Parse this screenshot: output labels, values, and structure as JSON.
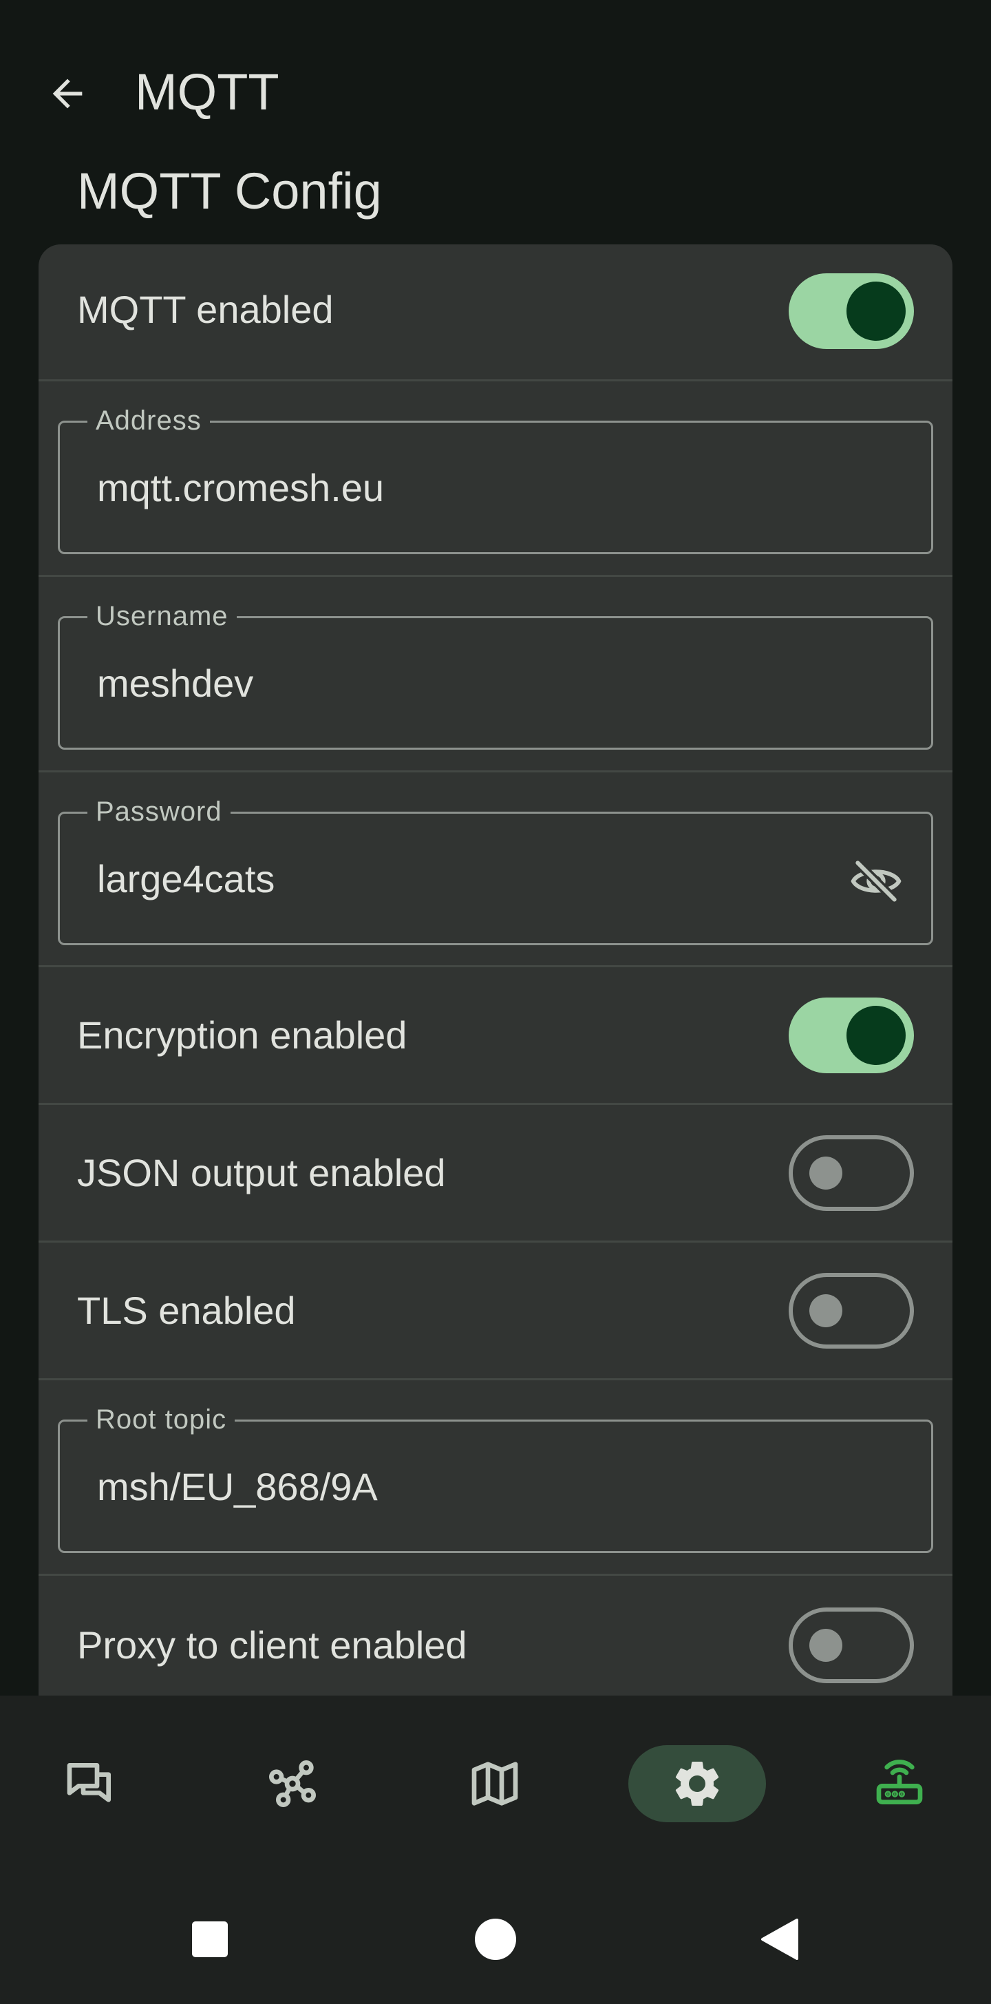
{
  "app_bar": {
    "title": "MQTT",
    "back_icon": "arrow-left-icon"
  },
  "section_title": "MQTT Config",
  "settings": {
    "mqtt_enabled": {
      "label": "MQTT enabled",
      "checked": true
    },
    "address": {
      "legend": "Address",
      "value": "mqtt.cromesh.eu"
    },
    "username": {
      "legend": "Username",
      "value": "meshdev"
    },
    "password": {
      "legend": "Password",
      "value": "large4cats",
      "visibility_icon": "eye-off-icon"
    },
    "encryption_enabled": {
      "label": "Encryption enabled",
      "checked": true
    },
    "json_output_enabled": {
      "label": "JSON output enabled",
      "checked": false
    },
    "tls_enabled": {
      "label": "TLS enabled",
      "checked": false
    },
    "root_topic": {
      "legend": "Root topic",
      "value": "msh/EU_868/9A"
    },
    "proxy_to_client_enabled": {
      "label": "Proxy to client enabled",
      "checked": false
    }
  },
  "bottom_nav": {
    "items": [
      {
        "icon": "messages-icon",
        "active": false
      },
      {
        "icon": "nodes-graph-icon",
        "active": false
      },
      {
        "icon": "map-icon",
        "active": false
      },
      {
        "icon": "settings-gear-icon",
        "active": true
      },
      {
        "icon": "router-wifi-icon",
        "active": false
      }
    ]
  },
  "system_nav": {
    "recents_icon": "square-icon",
    "home_icon": "circle-icon",
    "back_icon": "triangle-back-icon"
  },
  "colors": {
    "background": "#121714",
    "card": "#313432",
    "switch_on_track": "#9bd5a3",
    "switch_on_thumb": "#063b1c",
    "nav_active": "#344d3c",
    "router_icon": "#3fb04f"
  }
}
